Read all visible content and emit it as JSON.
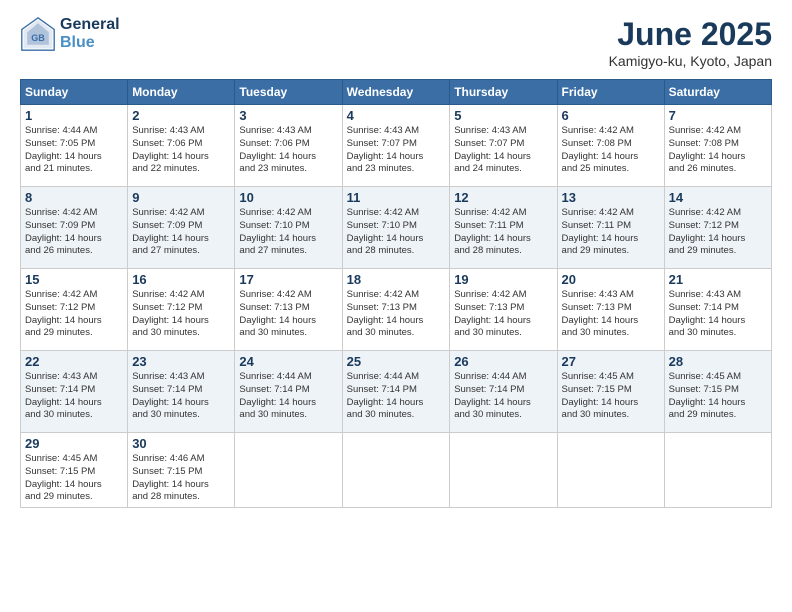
{
  "logo": {
    "line1": "General",
    "line2": "Blue"
  },
  "title": "June 2025",
  "location": "Kamigyo-ku, Kyoto, Japan",
  "weekdays": [
    "Sunday",
    "Monday",
    "Tuesday",
    "Wednesday",
    "Thursday",
    "Friday",
    "Saturday"
  ],
  "weeks": [
    [
      {
        "day": "1",
        "sunrise": "4:44 AM",
        "sunset": "7:05 PM",
        "daylight": "14 hours and 21 minutes."
      },
      {
        "day": "2",
        "sunrise": "4:43 AM",
        "sunset": "7:06 PM",
        "daylight": "14 hours and 22 minutes."
      },
      {
        "day": "3",
        "sunrise": "4:43 AM",
        "sunset": "7:06 PM",
        "daylight": "14 hours and 23 minutes."
      },
      {
        "day": "4",
        "sunrise": "4:43 AM",
        "sunset": "7:07 PM",
        "daylight": "14 hours and 23 minutes."
      },
      {
        "day": "5",
        "sunrise": "4:43 AM",
        "sunset": "7:07 PM",
        "daylight": "14 hours and 24 minutes."
      },
      {
        "day": "6",
        "sunrise": "4:42 AM",
        "sunset": "7:08 PM",
        "daylight": "14 hours and 25 minutes."
      },
      {
        "day": "7",
        "sunrise": "4:42 AM",
        "sunset": "7:08 PM",
        "daylight": "14 hours and 26 minutes."
      }
    ],
    [
      {
        "day": "8",
        "sunrise": "4:42 AM",
        "sunset": "7:09 PM",
        "daylight": "14 hours and 26 minutes."
      },
      {
        "day": "9",
        "sunrise": "4:42 AM",
        "sunset": "7:09 PM",
        "daylight": "14 hours and 27 minutes."
      },
      {
        "day": "10",
        "sunrise": "4:42 AM",
        "sunset": "7:10 PM",
        "daylight": "14 hours and 27 minutes."
      },
      {
        "day": "11",
        "sunrise": "4:42 AM",
        "sunset": "7:10 PM",
        "daylight": "14 hours and 28 minutes."
      },
      {
        "day": "12",
        "sunrise": "4:42 AM",
        "sunset": "7:11 PM",
        "daylight": "14 hours and 28 minutes."
      },
      {
        "day": "13",
        "sunrise": "4:42 AM",
        "sunset": "7:11 PM",
        "daylight": "14 hours and 29 minutes."
      },
      {
        "day": "14",
        "sunrise": "4:42 AM",
        "sunset": "7:12 PM",
        "daylight": "14 hours and 29 minutes."
      }
    ],
    [
      {
        "day": "15",
        "sunrise": "4:42 AM",
        "sunset": "7:12 PM",
        "daylight": "14 hours and 29 minutes."
      },
      {
        "day": "16",
        "sunrise": "4:42 AM",
        "sunset": "7:12 PM",
        "daylight": "14 hours and 30 minutes."
      },
      {
        "day": "17",
        "sunrise": "4:42 AM",
        "sunset": "7:13 PM",
        "daylight": "14 hours and 30 minutes."
      },
      {
        "day": "18",
        "sunrise": "4:42 AM",
        "sunset": "7:13 PM",
        "daylight": "14 hours and 30 minutes."
      },
      {
        "day": "19",
        "sunrise": "4:42 AM",
        "sunset": "7:13 PM",
        "daylight": "14 hours and 30 minutes."
      },
      {
        "day": "20",
        "sunrise": "4:43 AM",
        "sunset": "7:13 PM",
        "daylight": "14 hours and 30 minutes."
      },
      {
        "day": "21",
        "sunrise": "4:43 AM",
        "sunset": "7:14 PM",
        "daylight": "14 hours and 30 minutes."
      }
    ],
    [
      {
        "day": "22",
        "sunrise": "4:43 AM",
        "sunset": "7:14 PM",
        "daylight": "14 hours and 30 minutes."
      },
      {
        "day": "23",
        "sunrise": "4:43 AM",
        "sunset": "7:14 PM",
        "daylight": "14 hours and 30 minutes."
      },
      {
        "day": "24",
        "sunrise": "4:44 AM",
        "sunset": "7:14 PM",
        "daylight": "14 hours and 30 minutes."
      },
      {
        "day": "25",
        "sunrise": "4:44 AM",
        "sunset": "7:14 PM",
        "daylight": "14 hours and 30 minutes."
      },
      {
        "day": "26",
        "sunrise": "4:44 AM",
        "sunset": "7:14 PM",
        "daylight": "14 hours and 30 minutes."
      },
      {
        "day": "27",
        "sunrise": "4:45 AM",
        "sunset": "7:15 PM",
        "daylight": "14 hours and 30 minutes."
      },
      {
        "day": "28",
        "sunrise": "4:45 AM",
        "sunset": "7:15 PM",
        "daylight": "14 hours and 29 minutes."
      }
    ],
    [
      {
        "day": "29",
        "sunrise": "4:45 AM",
        "sunset": "7:15 PM",
        "daylight": "14 hours and 29 minutes."
      },
      {
        "day": "30",
        "sunrise": "4:46 AM",
        "sunset": "7:15 PM",
        "daylight": "14 hours and 28 minutes."
      },
      null,
      null,
      null,
      null,
      null
    ]
  ],
  "labels": {
    "sunrise": "Sunrise:",
    "sunset": "Sunset:",
    "daylight": "Daylight:"
  }
}
